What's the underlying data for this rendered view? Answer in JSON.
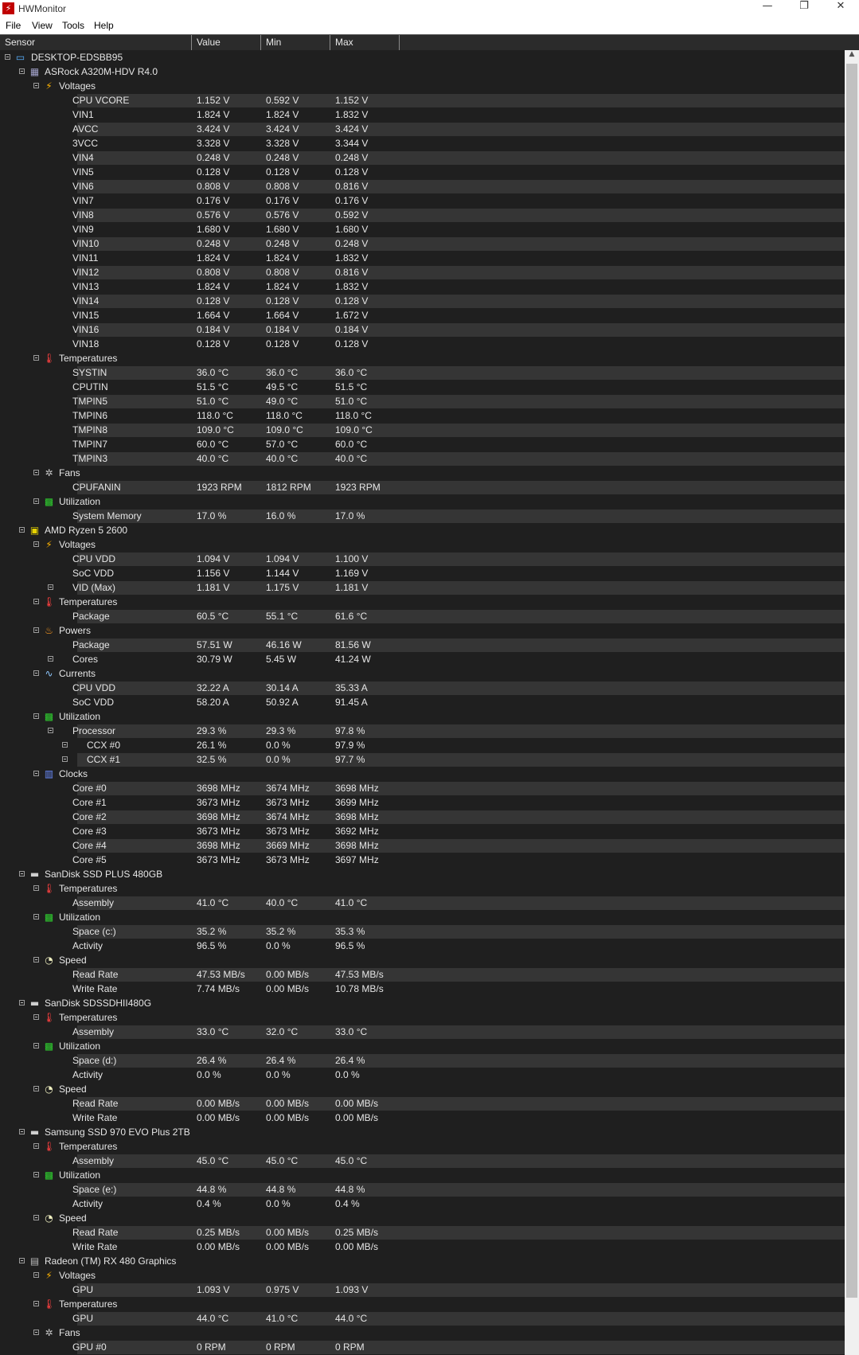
{
  "window": {
    "title": "HWMonitor",
    "icon_glyph": "⚡",
    "controls": {
      "minimize": "—",
      "maximize": "❐",
      "close": "✕"
    }
  },
  "menu": [
    "File",
    "View",
    "Tools",
    "Help"
  ],
  "columns": {
    "sensor": "Sensor",
    "value": "Value",
    "min": "Min",
    "max": "Max"
  },
  "rows": [
    {
      "t": "root",
      "label": "DESKTOP-EDSBB95",
      "icon": "computer-icon"
    },
    {
      "t": "device",
      "label": "ASRock A320M-HDV R4.0",
      "icon": "motherboard-icon"
    },
    {
      "t": "group",
      "label": "Voltages",
      "icon": "voltage-icon"
    },
    {
      "t": "s",
      "label": "CPU VCORE",
      "value": "1.152 V",
      "min": "0.592 V",
      "max": "1.152 V"
    },
    {
      "t": "s",
      "label": "VIN1",
      "value": "1.824 V",
      "min": "1.824 V",
      "max": "1.832 V"
    },
    {
      "t": "s",
      "label": "AVCC",
      "value": "3.424 V",
      "min": "3.424 V",
      "max": "3.424 V"
    },
    {
      "t": "s",
      "label": "3VCC",
      "value": "3.328 V",
      "min": "3.328 V",
      "max": "3.344 V"
    },
    {
      "t": "s",
      "label": "VIN4",
      "value": "0.248 V",
      "min": "0.248 V",
      "max": "0.248 V"
    },
    {
      "t": "s",
      "label": "VIN5",
      "value": "0.128 V",
      "min": "0.128 V",
      "max": "0.128 V"
    },
    {
      "t": "s",
      "label": "VIN6",
      "value": "0.808 V",
      "min": "0.808 V",
      "max": "0.816 V"
    },
    {
      "t": "s",
      "label": "VIN7",
      "value": "0.176 V",
      "min": "0.176 V",
      "max": "0.176 V"
    },
    {
      "t": "s",
      "label": "VIN8",
      "value": "0.576 V",
      "min": "0.576 V",
      "max": "0.592 V"
    },
    {
      "t": "s",
      "label": "VIN9",
      "value": "1.680 V",
      "min": "1.680 V",
      "max": "1.680 V"
    },
    {
      "t": "s",
      "label": "VIN10",
      "value": "0.248 V",
      "min": "0.248 V",
      "max": "0.248 V"
    },
    {
      "t": "s",
      "label": "VIN11",
      "value": "1.824 V",
      "min": "1.824 V",
      "max": "1.832 V"
    },
    {
      "t": "s",
      "label": "VIN12",
      "value": "0.808 V",
      "min": "0.808 V",
      "max": "0.816 V"
    },
    {
      "t": "s",
      "label": "VIN13",
      "value": "1.824 V",
      "min": "1.824 V",
      "max": "1.832 V"
    },
    {
      "t": "s",
      "label": "VIN14",
      "value": "0.128 V",
      "min": "0.128 V",
      "max": "0.128 V"
    },
    {
      "t": "s",
      "label": "VIN15",
      "value": "1.664 V",
      "min": "1.664 V",
      "max": "1.672 V"
    },
    {
      "t": "s",
      "label": "VIN16",
      "value": "0.184 V",
      "min": "0.184 V",
      "max": "0.184 V"
    },
    {
      "t": "s",
      "label": "VIN18",
      "value": "0.128 V",
      "min": "0.128 V",
      "max": "0.128 V"
    },
    {
      "t": "group",
      "label": "Temperatures",
      "icon": "thermometer-icon"
    },
    {
      "t": "s",
      "label": "SYSTIN",
      "value": "36.0 °C",
      "min": "36.0 °C",
      "max": "36.0 °C"
    },
    {
      "t": "s",
      "label": "CPUTIN",
      "value": "51.5 °C",
      "min": "49.5 °C",
      "max": "51.5 °C"
    },
    {
      "t": "s",
      "label": "TMPIN5",
      "value": "51.0 °C",
      "min": "49.0 °C",
      "max": "51.0 °C"
    },
    {
      "t": "s",
      "label": "TMPIN6",
      "value": "118.0 °C",
      "min": "118.0 °C",
      "max": "118.0 °C"
    },
    {
      "t": "s",
      "label": "TMPIN8",
      "value": "109.0 °C",
      "min": "109.0 °C",
      "max": "109.0 °C"
    },
    {
      "t": "s",
      "label": "TMPIN7",
      "value": "60.0 °C",
      "min": "57.0 °C",
      "max": "60.0 °C"
    },
    {
      "t": "s",
      "label": "TMPIN3",
      "value": "40.0 °C",
      "min": "40.0 °C",
      "max": "40.0 °C"
    },
    {
      "t": "group",
      "label": "Fans",
      "icon": "fan-icon"
    },
    {
      "t": "s",
      "label": "CPUFANIN",
      "value": "1923 RPM",
      "min": "1812 RPM",
      "max": "1923 RPM"
    },
    {
      "t": "group",
      "label": "Utilization",
      "icon": "utilization-icon"
    },
    {
      "t": "s",
      "label": "System Memory",
      "value": "17.0 %",
      "min": "16.0 %",
      "max": "17.0 %"
    },
    {
      "t": "device",
      "label": "AMD Ryzen 5 2600",
      "icon": "cpu-icon"
    },
    {
      "t": "group",
      "label": "Voltages",
      "icon": "voltage-icon"
    },
    {
      "t": "s",
      "label": "CPU VDD",
      "value": "1.094 V",
      "min": "1.094 V",
      "max": "1.100 V"
    },
    {
      "t": "s",
      "label": "SoC VDD",
      "value": "1.156 V",
      "min": "1.144 V",
      "max": "1.169 V"
    },
    {
      "t": "s",
      "label": "VID (Max)",
      "value": "1.181 V",
      "min": "1.175 V",
      "max": "1.181 V",
      "toggle": true
    },
    {
      "t": "group",
      "label": "Temperatures",
      "icon": "thermometer-icon"
    },
    {
      "t": "s",
      "label": "Package",
      "value": "60.5 °C",
      "min": "55.1 °C",
      "max": "61.6 °C"
    },
    {
      "t": "group",
      "label": "Powers",
      "icon": "power-icon"
    },
    {
      "t": "s",
      "label": "Package",
      "value": "57.51 W",
      "min": "46.16 W",
      "max": "81.56 W"
    },
    {
      "t": "s",
      "label": "Cores",
      "value": "30.79 W",
      "min": "5.45 W",
      "max": "41.24 W",
      "toggle": true
    },
    {
      "t": "group",
      "label": "Currents",
      "icon": "current-icon"
    },
    {
      "t": "s",
      "label": "CPU VDD",
      "value": "32.22 A",
      "min": "30.14 A",
      "max": "35.33 A"
    },
    {
      "t": "s",
      "label": "SoC VDD",
      "value": "58.20 A",
      "min": "50.92 A",
      "max": "91.45 A"
    },
    {
      "t": "group",
      "label": "Utilization",
      "icon": "utilization-icon"
    },
    {
      "t": "s",
      "label": "Processor",
      "value": "29.3 %",
      "min": "29.3 %",
      "max": "97.8 %",
      "toggle": true
    },
    {
      "t": "sub",
      "label": "CCX #0",
      "value": "26.1 %",
      "min": "0.0 %",
      "max": "97.9 %"
    },
    {
      "t": "sub",
      "label": "CCX #1",
      "value": "32.5 %",
      "min": "0.0 %",
      "max": "97.7 %"
    },
    {
      "t": "group",
      "label": "Clocks",
      "icon": "clock-icon"
    },
    {
      "t": "s",
      "label": "Core #0",
      "value": "3698 MHz",
      "min": "3674 MHz",
      "max": "3698 MHz"
    },
    {
      "t": "s",
      "label": "Core #1",
      "value": "3673 MHz",
      "min": "3673 MHz",
      "max": "3699 MHz"
    },
    {
      "t": "s",
      "label": "Core #2",
      "value": "3698 MHz",
      "min": "3674 MHz",
      "max": "3698 MHz"
    },
    {
      "t": "s",
      "label": "Core #3",
      "value": "3673 MHz",
      "min": "3673 MHz",
      "max": "3692 MHz"
    },
    {
      "t": "s",
      "label": "Core #4",
      "value": "3698 MHz",
      "min": "3669 MHz",
      "max": "3698 MHz"
    },
    {
      "t": "s",
      "label": "Core #5",
      "value": "3673 MHz",
      "min": "3673 MHz",
      "max": "3697 MHz"
    },
    {
      "t": "device",
      "label": "SanDisk SSD PLUS 480GB",
      "icon": "disk-icon"
    },
    {
      "t": "group",
      "label": "Temperatures",
      "icon": "thermometer-icon"
    },
    {
      "t": "s",
      "label": "Assembly",
      "value": "41.0 °C",
      "min": "40.0 °C",
      "max": "41.0 °C"
    },
    {
      "t": "group",
      "label": "Utilization",
      "icon": "utilization-icon"
    },
    {
      "t": "s",
      "label": "Space (c:)",
      "value": "35.2 %",
      "min": "35.2 %",
      "max": "35.3 %"
    },
    {
      "t": "s",
      "label": "Activity",
      "value": "96.5 %",
      "min": "0.0 %",
      "max": "96.5 %"
    },
    {
      "t": "group",
      "label": "Speed",
      "icon": "speed-icon"
    },
    {
      "t": "s",
      "label": "Read Rate",
      "value": "47.53 MB/s",
      "min": "0.00 MB/s",
      "max": "47.53 MB/s"
    },
    {
      "t": "s",
      "label": "Write Rate",
      "value": "7.74 MB/s",
      "min": "0.00 MB/s",
      "max": "10.78 MB/s"
    },
    {
      "t": "device",
      "label": "SanDisk SDSSDHII480G",
      "icon": "disk-icon"
    },
    {
      "t": "group",
      "label": "Temperatures",
      "icon": "thermometer-icon"
    },
    {
      "t": "s",
      "label": "Assembly",
      "value": "33.0 °C",
      "min": "32.0 °C",
      "max": "33.0 °C"
    },
    {
      "t": "group",
      "label": "Utilization",
      "icon": "utilization-icon"
    },
    {
      "t": "s",
      "label": "Space (d:)",
      "value": "26.4 %",
      "min": "26.4 %",
      "max": "26.4 %"
    },
    {
      "t": "s",
      "label": "Activity",
      "value": "0.0 %",
      "min": "0.0 %",
      "max": "0.0 %"
    },
    {
      "t": "group",
      "label": "Speed",
      "icon": "speed-icon"
    },
    {
      "t": "s",
      "label": "Read Rate",
      "value": "0.00 MB/s",
      "min": "0.00 MB/s",
      "max": "0.00 MB/s"
    },
    {
      "t": "s",
      "label": "Write Rate",
      "value": "0.00 MB/s",
      "min": "0.00 MB/s",
      "max": "0.00 MB/s"
    },
    {
      "t": "device",
      "label": "Samsung SSD 970 EVO Plus 2TB",
      "icon": "disk-icon"
    },
    {
      "t": "group",
      "label": "Temperatures",
      "icon": "thermometer-icon"
    },
    {
      "t": "s",
      "label": "Assembly",
      "value": "45.0 °C",
      "min": "45.0 °C",
      "max": "45.0 °C"
    },
    {
      "t": "group",
      "label": "Utilization",
      "icon": "utilization-icon"
    },
    {
      "t": "s",
      "label": "Space (e:)",
      "value": "44.8 %",
      "min": "44.8 %",
      "max": "44.8 %"
    },
    {
      "t": "s",
      "label": "Activity",
      "value": "0.4 %",
      "min": "0.0 %",
      "max": "0.4 %"
    },
    {
      "t": "group",
      "label": "Speed",
      "icon": "speed-icon"
    },
    {
      "t": "s",
      "label": "Read Rate",
      "value": "0.25 MB/s",
      "min": "0.00 MB/s",
      "max": "0.25 MB/s"
    },
    {
      "t": "s",
      "label": "Write Rate",
      "value": "0.00 MB/s",
      "min": "0.00 MB/s",
      "max": "0.00 MB/s"
    },
    {
      "t": "device",
      "label": "Radeon (TM) RX 480 Graphics",
      "icon": "gpu-icon"
    },
    {
      "t": "group",
      "label": "Voltages",
      "icon": "voltage-icon"
    },
    {
      "t": "s",
      "label": "GPU",
      "value": "1.093 V",
      "min": "0.975 V",
      "max": "1.093 V"
    },
    {
      "t": "group",
      "label": "Temperatures",
      "icon": "thermometer-icon"
    },
    {
      "t": "s",
      "label": "GPU",
      "value": "44.0 °C",
      "min": "41.0 °C",
      "max": "44.0 °C"
    },
    {
      "t": "group",
      "label": "Fans",
      "icon": "fan-icon"
    },
    {
      "t": "s",
      "label": "GPU #0",
      "value": "0 RPM",
      "min": "0 RPM",
      "max": "0 RPM"
    }
  ],
  "colors": {
    "tree_bg": "#1f1f1f",
    "row_alt": "#353535",
    "text": "#e6e6e6",
    "header_bg": "#2b2b2b",
    "app_icon": "#c00000"
  }
}
